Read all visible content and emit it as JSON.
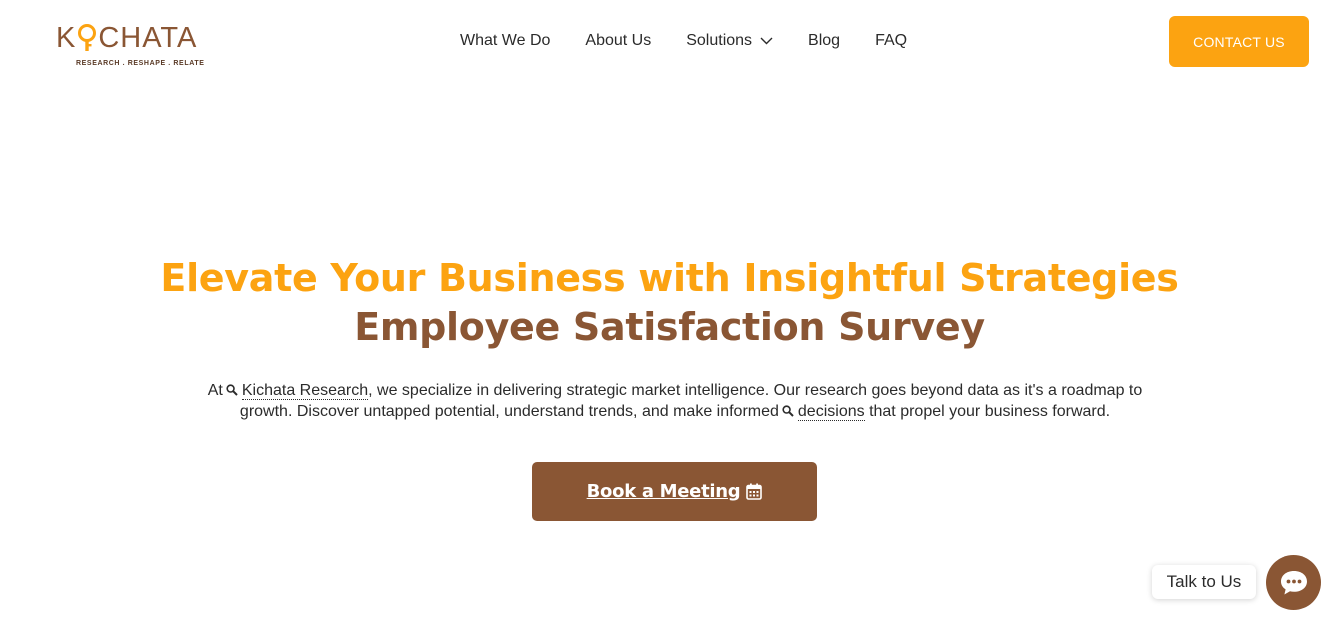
{
  "header": {
    "logo": {
      "text_k": "K",
      "text_rest": "CHATA",
      "tagline": "RESEARCH . RESHAPE . RELATE",
      "icon": "key-icon"
    },
    "nav": [
      {
        "label": "What We Do"
      },
      {
        "label": "About Us"
      },
      {
        "label": "Solutions",
        "icon": "chevron-down-icon"
      },
      {
        "label": "Blog"
      },
      {
        "label": "FAQ"
      }
    ],
    "contact_label": "CONTACT US"
  },
  "hero": {
    "title_line1": "Elevate Your Business with Insightful Strategies",
    "title_line2": "Employee Satisfaction Survey",
    "desc_part1": "At",
    "desc_link1": "Kichata Research",
    "desc_part2": ", we specialize in delivering strategic market intelligence. Our research goes beyond data as it's a roadmap to growth. Discover untapped potential, understand trends, and make informed",
    "desc_link2": "decisions",
    "desc_part3": "that propel your business forward.",
    "cta_label": "Book a Meeting",
    "cta_icon": "calendar-icon"
  },
  "chat": {
    "label": "Talk to Us",
    "icon": "chat-bubble-icon"
  },
  "colors": {
    "accent": "#fca311",
    "brand": "#8a5634",
    "text": "#2b2b2b"
  }
}
